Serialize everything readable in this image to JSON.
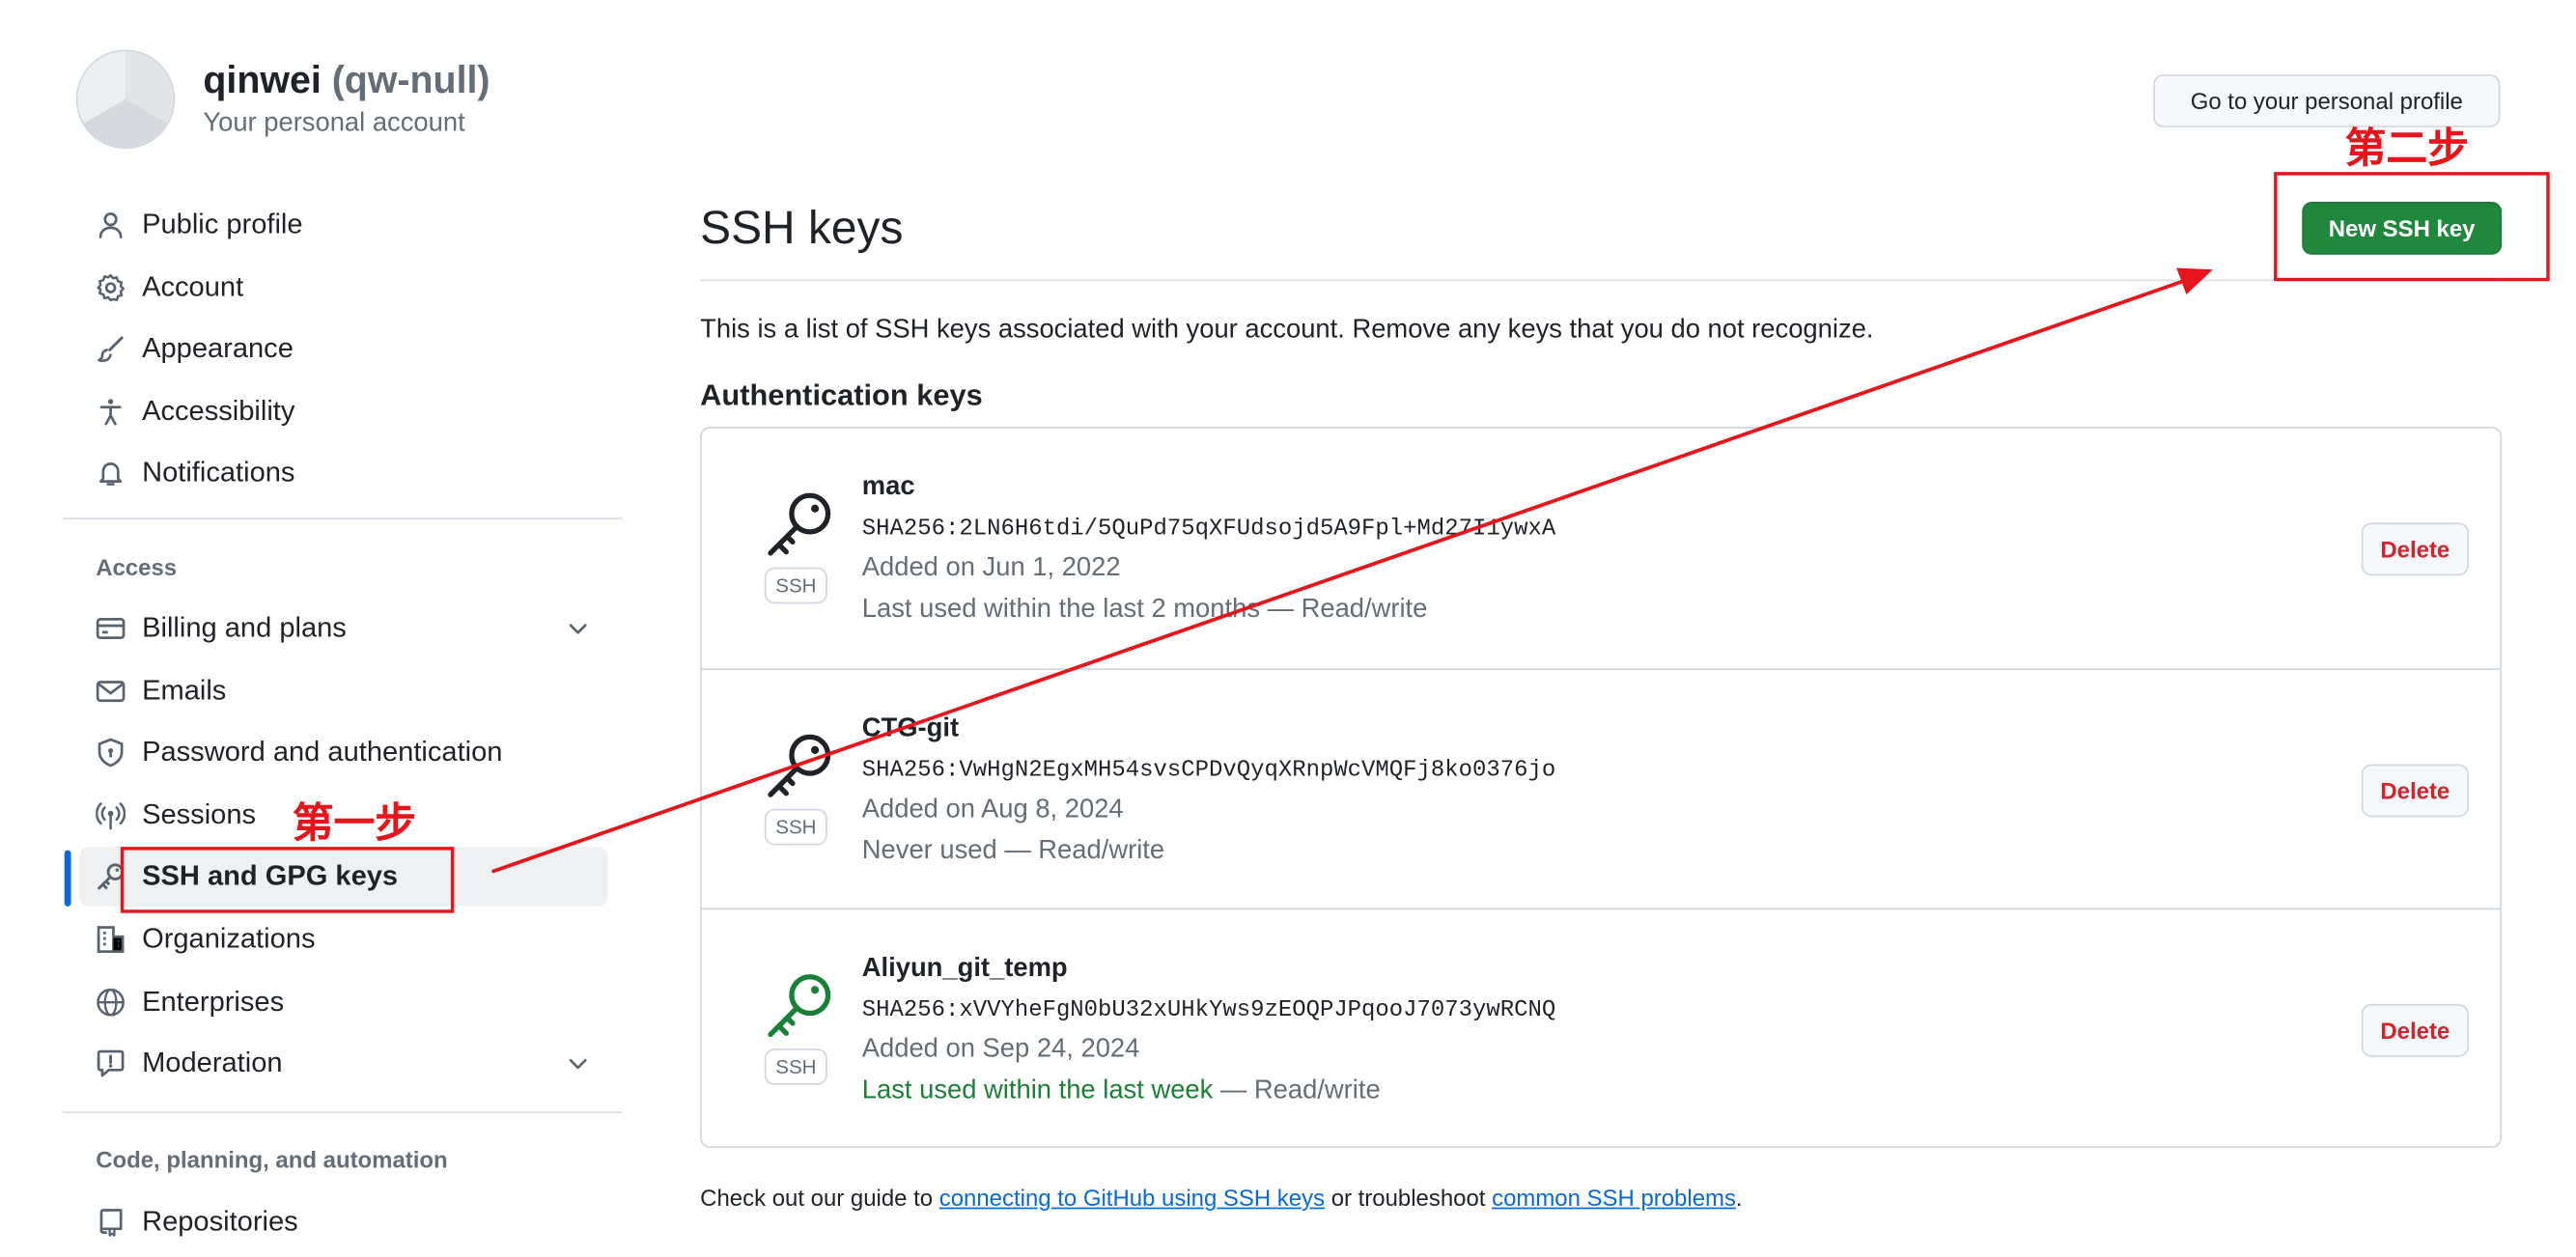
{
  "header": {
    "user_name": "qinwei",
    "user_handle": "(qw-null)",
    "account_label": "Your personal account",
    "profile_button": "Go to your personal profile"
  },
  "sidebar": {
    "items": [
      {
        "label": "Public profile",
        "icon": "person-icon"
      },
      {
        "label": "Account",
        "icon": "gear-icon"
      },
      {
        "label": "Appearance",
        "icon": "paintbrush-icon"
      },
      {
        "label": "Accessibility",
        "icon": "accessibility-icon"
      },
      {
        "label": "Notifications",
        "icon": "bell-icon"
      }
    ],
    "access_heading": "Access",
    "access_items": [
      {
        "label": "Billing and plans",
        "icon": "credit-card-icon",
        "expandable": true
      },
      {
        "label": "Emails",
        "icon": "mail-icon"
      },
      {
        "label": "Password and authentication",
        "icon": "shield-lock-icon"
      },
      {
        "label": "Sessions",
        "icon": "broadcast-icon"
      },
      {
        "label": "SSH and GPG keys",
        "icon": "key-icon",
        "selected": true
      },
      {
        "label": "Organizations",
        "icon": "organization-icon"
      },
      {
        "label": "Enterprises",
        "icon": "globe-icon"
      },
      {
        "label": "Moderation",
        "icon": "report-icon",
        "expandable": true
      }
    ],
    "code_heading": "Code, planning, and automation",
    "code_items": [
      {
        "label": "Repositories",
        "icon": "repo-icon"
      }
    ]
  },
  "main": {
    "title": "SSH keys",
    "new_key_button": "New SSH key",
    "intro": "This is a list of SSH keys associated with your account. Remove any keys that you do not recognize.",
    "section_heading": "Authentication keys",
    "keys": [
      {
        "title": "mac",
        "fingerprint": "SHA256:2LN6H6tdi/5QuPd75qXFUdsojd5A9Fpl+Md27I1ywxA",
        "added": "Added on Jun 1, 2022",
        "last_used": "Last used within the last 2 months",
        "last_used_recent": false,
        "access": " — Read/write",
        "badge": "SSH",
        "delete_label": "Delete",
        "icon_color": "#1f2328"
      },
      {
        "title": "CTG-git",
        "fingerprint": "SHA256:VwHgN2EgxMH54svsCPDvQyqXRnpWcVMQFj8ko0376jo",
        "added": "Added on Aug 8, 2024",
        "last_used": "Never used",
        "last_used_recent": false,
        "access": " — Read/write",
        "badge": "SSH",
        "delete_label": "Delete",
        "icon_color": "#1f2328"
      },
      {
        "title": "Aliyun_git_temp",
        "fingerprint": "SHA256:xVVYheFgN0bU32xUHkYws9zEOQPJPqooJ7073ywRCNQ",
        "added": "Added on Sep 24, 2024",
        "last_used": "Last used within the last week",
        "last_used_recent": true,
        "access": " — Read/write",
        "badge": "SSH",
        "delete_label": "Delete",
        "icon_color": "#1a7f37"
      }
    ],
    "footer": {
      "prefix": "Check out our guide to ",
      "link1": "connecting to GitHub using SSH keys",
      "middle": " or troubleshoot ",
      "link2": "common SSH problems",
      "suffix": "."
    }
  },
  "annotations": {
    "step1": "第一步",
    "step2": "第二步",
    "color": "#e8141b"
  },
  "colors": {
    "accent": "#0969da",
    "primary_button": "#1f883d",
    "danger": "#d1242f",
    "success": "#1a7f37"
  }
}
